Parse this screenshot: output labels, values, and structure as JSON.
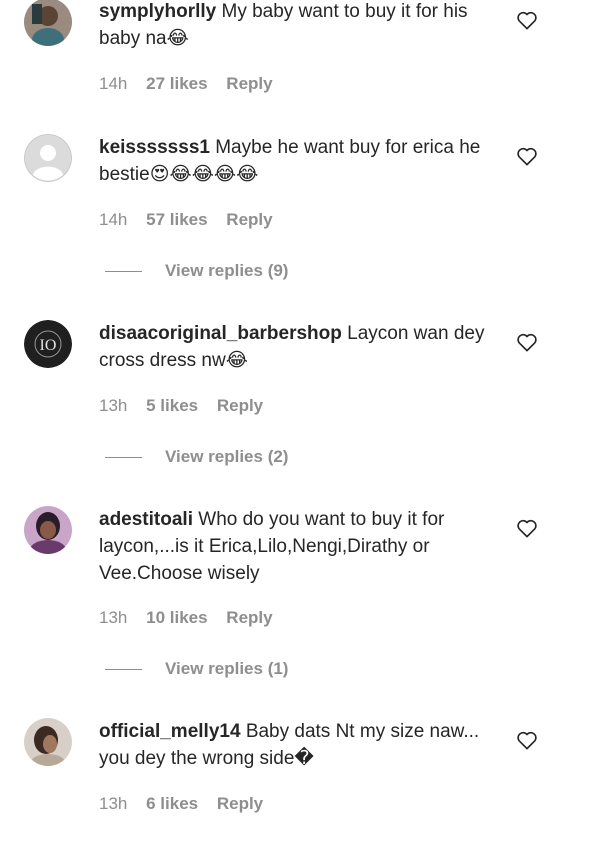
{
  "comments": [
    {
      "username": "symplyhorlly",
      "text": "My baby want to buy it for his baby na😂",
      "time": "14h",
      "likes": "27 likes",
      "reply": "Reply",
      "avatar": "photo-avatar"
    },
    {
      "username": "keisssssss1",
      "text": "Maybe he want buy for erica he bestie😍😂😂😂😂",
      "time": "14h",
      "likes": "57 likes",
      "reply": "Reply",
      "replies": "View replies (9)",
      "avatar": "default-avatar"
    },
    {
      "username": "disaacoriginal_barbershop",
      "text": "Laycon wan dey cross dress nw😂",
      "time": "13h",
      "likes": "5 likes",
      "reply": "Reply",
      "replies": "View replies (2)",
      "avatar": "logo-avatar",
      "avatar_logo_text": "IO"
    },
    {
      "username": "adestitoali",
      "text": "Who do you want to buy it for laycon,...is it Erica,Lilo,Nengi,Dirathy or Vee.Choose wisely",
      "time": "13h",
      "likes": "10 likes",
      "reply": "Reply",
      "replies": "View replies (1)",
      "avatar": "photo-avatar"
    },
    {
      "username": "official_melly14",
      "text": "Baby dats Nt my size naw... you dey the wrong side�",
      "time": "13h",
      "likes": "6 likes",
      "reply": "Reply",
      "avatar": "photo-avatar"
    }
  ],
  "icons": {
    "like": "heart-outline-icon"
  },
  "colors": {
    "text": "#262626",
    "secondary": "#8e8e8e"
  }
}
